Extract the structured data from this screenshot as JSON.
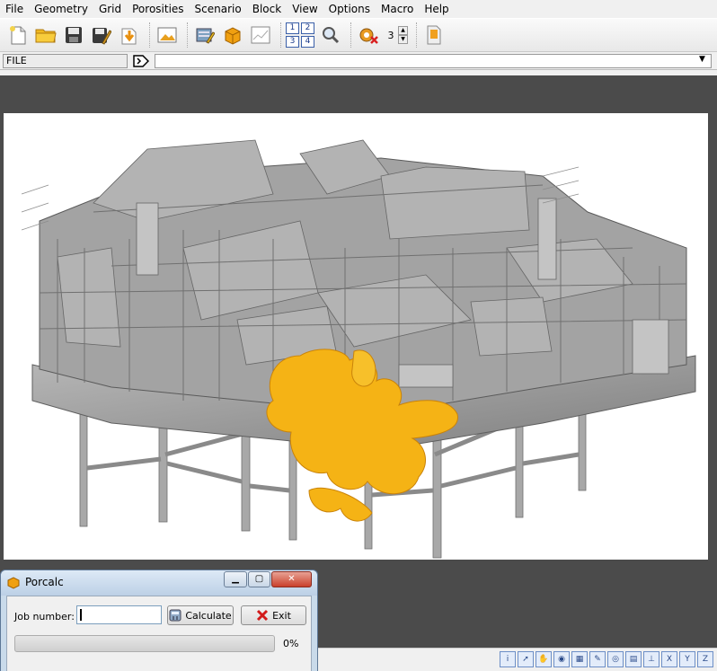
{
  "menu": [
    "File",
    "Geometry",
    "Grid",
    "Porosities",
    "Scenario",
    "Block",
    "View",
    "Options",
    "Macro",
    "Help"
  ],
  "toolbar": {
    "view_numbers": [
      "1",
      "2",
      "3",
      "4"
    ],
    "spin_value": "3"
  },
  "command": {
    "label": "FILE",
    "input_value": ""
  },
  "dialog": {
    "title": "Porcalc",
    "job_label": "Job number:",
    "job_value": "",
    "calculate_label": "Calculate",
    "exit_label": "Exit",
    "progress": 0,
    "progress_text": "0%"
  },
  "colors": {
    "viewport_bg": "#4b4b4b",
    "structure_gray": "#9a9a9a",
    "gas_cloud": "#f5b315",
    "progress_green": "#3cb24a"
  }
}
